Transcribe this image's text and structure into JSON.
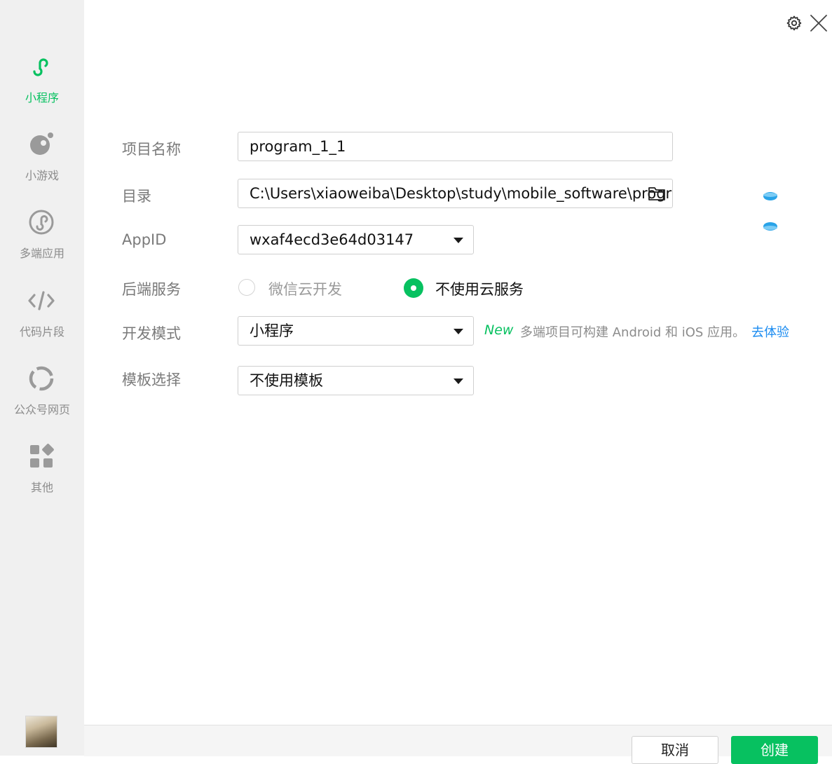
{
  "sidebar": {
    "items": [
      {
        "label": "小程序",
        "icon": "mini-program-icon"
      },
      {
        "label": "小游戏",
        "icon": "mini-game-icon"
      },
      {
        "label": "多端应用",
        "icon": "multi-platform-icon"
      },
      {
        "label": "代码片段",
        "icon": "code-snippet-icon"
      },
      {
        "label": "公众号网页",
        "icon": "official-account-icon"
      },
      {
        "label": "其他",
        "icon": "grid-icon"
      }
    ],
    "active_index": 0
  },
  "form": {
    "project_name": {
      "label": "项目名称",
      "value": "program_1_1"
    },
    "directory": {
      "label": "目录",
      "value": "C:\\Users\\xiaoweiba\\Desktop\\study\\mobile_software\\progr"
    },
    "appid": {
      "label": "AppID",
      "value": "wxaf4ecd3e64d03147"
    },
    "backend": {
      "label": "后端服务",
      "options": [
        "微信云开发",
        "不使用云服务"
      ],
      "selected_index": 1
    },
    "dev_mode": {
      "label": "开发模式",
      "value": "小程序",
      "new_badge": "New",
      "hint": "多端项目可构建 Android 和 iOS 应用。",
      "link": "去体验"
    },
    "template": {
      "label": "模板选择",
      "value": "不使用模板"
    }
  },
  "footer": {
    "cancel": "取消",
    "create": "创建"
  },
  "colors": {
    "accent": "#07c160",
    "link": "#1a8bf0",
    "sidebar_bg": "#f0f0f0"
  }
}
